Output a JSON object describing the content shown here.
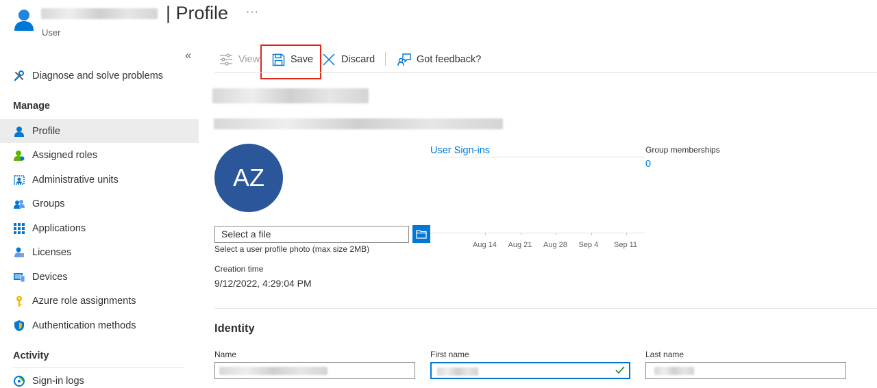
{
  "header": {
    "title": "| Profile",
    "more": "···",
    "subtitle": "User"
  },
  "sidebar": {
    "collapse_icon": "«",
    "top_item": {
      "label": "Diagnose and solve problems",
      "icon": "wrench-icon"
    },
    "sections": [
      {
        "title": "Manage",
        "items": [
          {
            "label": "Profile",
            "icon": "user-icon",
            "active": true
          },
          {
            "label": "Assigned roles",
            "icon": "user-role-icon"
          },
          {
            "label": "Administrative units",
            "icon": "admin-units-icon"
          },
          {
            "label": "Groups",
            "icon": "groups-icon"
          },
          {
            "label": "Applications",
            "icon": "grid-icon"
          },
          {
            "label": "Licenses",
            "icon": "license-icon"
          },
          {
            "label": "Devices",
            "icon": "device-icon"
          },
          {
            "label": "Azure role assignments",
            "icon": "key-icon"
          },
          {
            "label": "Authentication methods",
            "icon": "shield-icon"
          }
        ]
      },
      {
        "title": "Activity",
        "items": [
          {
            "label": "Sign-in logs",
            "icon": "sign-in-icon"
          }
        ]
      }
    ]
  },
  "toolbar": {
    "view_label": "View",
    "save_label": "Save",
    "discard_label": "Discard",
    "feedback_label": "Got feedback?"
  },
  "profile": {
    "avatar_initials": "AZ",
    "file_placeholder": "Select a file",
    "file_hint": "Select a user profile photo (max size 2MB)",
    "creation_time_label": "Creation time",
    "creation_time_value": "9/12/2022, 4:29:04 PM"
  },
  "stats": {
    "signins_link": "User Sign-ins",
    "group_memberships_label": "Group memberships",
    "group_memberships_value": "0"
  },
  "chart_data": {
    "type": "line",
    "title": "",
    "x": [
      "Aug 14",
      "Aug 21",
      "Aug 28",
      "Sep 4",
      "Sep 11"
    ],
    "series": []
  },
  "identity": {
    "title": "Identity",
    "name_label": "Name",
    "first_name_label": "First name",
    "last_name_label": "Last name"
  },
  "colors": {
    "accent": "#0078d4",
    "avatar": "#2b579a",
    "highlight": "#e0271a"
  }
}
